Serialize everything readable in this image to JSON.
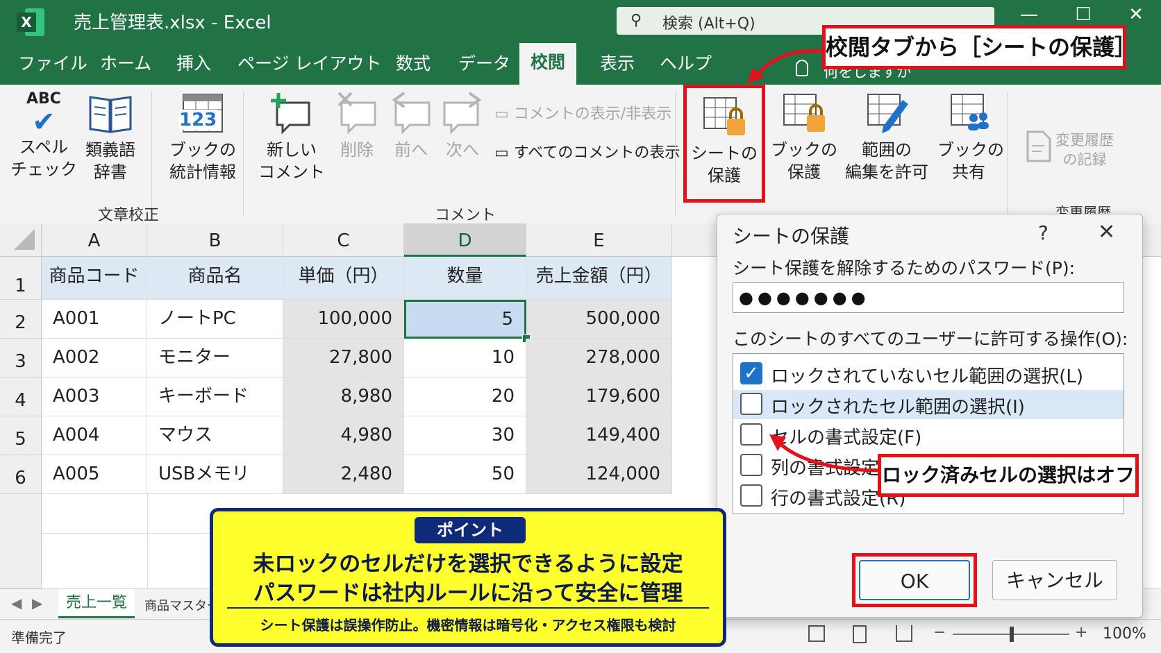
{
  "window": {
    "title": "売上管理表.xlsx  -  Excel",
    "search_placeholder": "検索 (Alt+Q)"
  },
  "tabs": [
    "ファイル",
    "ホーム",
    "挿入",
    "ページ レイアウト",
    "数式",
    "データ",
    "校閲",
    "表示",
    "ヘルプ"
  ],
  "active_tab": "校閲",
  "tell_me": "何をしますか",
  "ribbon": {
    "spell_abc": "ABC",
    "spell": [
      "スペル",
      "チェック"
    ],
    "thesaurus": [
      "類義語",
      "辞書"
    ],
    "stats": [
      "ブックの",
      "統計情報"
    ],
    "stats_num": "123",
    "group_proofing": "文章校正",
    "new_comment": [
      "新しい",
      "コメント"
    ],
    "delete": "削除",
    "prev": "前へ",
    "next": "次へ",
    "show_hide_comment": "コメントの表示/非表示",
    "show_all_comments": "すべてのコメントの表示",
    "group_comments": "コメント",
    "protect_sheet": [
      "シートの",
      "保護"
    ],
    "protect_book": [
      "ブックの",
      "保護"
    ],
    "allow_edit": [
      "範囲の",
      "編集を許可"
    ],
    "share_book": [
      "ブックの",
      "共有"
    ],
    "track_changes": [
      "変更履歴",
      "の記録"
    ],
    "group_changes": "変更履歴"
  },
  "callouts": {
    "ribbon_tag": "校閲タブから［シートの保護］",
    "lock_tag": "ロック済みセルの選択はオフ"
  },
  "sheet": {
    "columns": [
      "A",
      "B",
      "C",
      "D",
      "E"
    ],
    "row_numbers": [
      "1",
      "2",
      "3",
      "4",
      "5",
      "6"
    ],
    "headers": [
      "商品コード",
      "商品名",
      "単価（円）",
      "数量",
      "売上金額（円）"
    ],
    "rows": [
      [
        "A001",
        "ノートPC",
        "100,000",
        "5",
        "500,000"
      ],
      [
        "A002",
        "モニター",
        "27,800",
        "10",
        "278,000"
      ],
      [
        "A003",
        "キーボード",
        "8,980",
        "20",
        "179,600"
      ],
      [
        "A004",
        "マウス",
        "4,980",
        "30",
        "149,400"
      ],
      [
        "A005",
        "USBメモリ",
        "2,480",
        "50",
        "124,000"
      ]
    ],
    "selected_cell": "D2"
  },
  "sheet_tabs": [
    "売上一覧",
    "商品マスター"
  ],
  "status": {
    "ready": "準備完了",
    "zoom": "100%"
  },
  "dialog": {
    "title": "シートの保護",
    "help": "?",
    "password_label": "シート保護を解除するためのパスワード(P):",
    "password_value": "●●●●●●●",
    "allow_label": "このシートのすべてのユーザーに許可する操作(O):",
    "options": [
      {
        "label": "ロックされていないセル範囲の選択(L)",
        "checked": true
      },
      {
        "label": "ロックされたセル範囲の選択(I)",
        "checked": false
      },
      {
        "label": "セルの書式設定(F)",
        "checked": false
      },
      {
        "label": "列の書式設定(M)",
        "checked": false
      },
      {
        "label": "行の書式設定(R)",
        "checked": false
      }
    ],
    "ok": "OK",
    "cancel": "キャンセル"
  },
  "point": {
    "badge": "ポイント",
    "line1": "未ロックのセルだけを選択できるように設定",
    "line2": "パスワードは社内ルールに沿って安全に管理",
    "note": "シート保護は誤操作防止。機密情報は暗号化・アクセス権限も検討"
  },
  "colors": {
    "excel_green": "#217346",
    "accent_red": "#e3111b",
    "point_yellow": "#ffff2e",
    "point_navy": "#0e2a78"
  }
}
